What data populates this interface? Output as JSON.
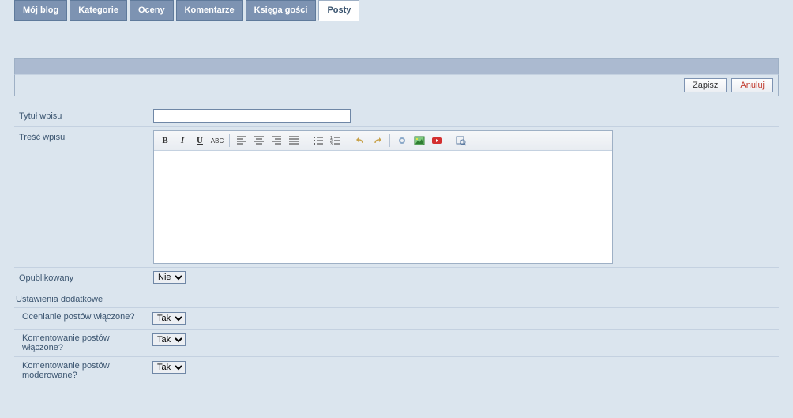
{
  "tabs": [
    {
      "label": "Mój blog",
      "active": false
    },
    {
      "label": "Kategorie",
      "active": false
    },
    {
      "label": "Oceny",
      "active": false
    },
    {
      "label": "Komentarze",
      "active": false
    },
    {
      "label": "Księga gości",
      "active": false
    },
    {
      "label": "Posty",
      "active": true
    }
  ],
  "buttons": {
    "save": "Zapisz",
    "cancel": "Anuluj"
  },
  "form": {
    "title_label": "Tytuł wpisu",
    "title_value": "",
    "content_label": "Treść wpisu",
    "published_label": "Opublikowany",
    "published_value": "Nie",
    "published_options": [
      "Nie",
      "Tak"
    ]
  },
  "settings": {
    "header": "Ustawienia dodatkowe",
    "rows": [
      {
        "label": "Ocenianie postów włączone?",
        "value": "Tak"
      },
      {
        "label": "Komentowanie postów włączone?",
        "value": "Tak"
      },
      {
        "label": "Komentowanie postów moderowane?",
        "value": "Tak"
      }
    ],
    "options": [
      "Tak",
      "Nie"
    ]
  },
  "toolbar": {
    "bold": "B",
    "italic": "I",
    "underline": "U",
    "strike": "ABC"
  }
}
